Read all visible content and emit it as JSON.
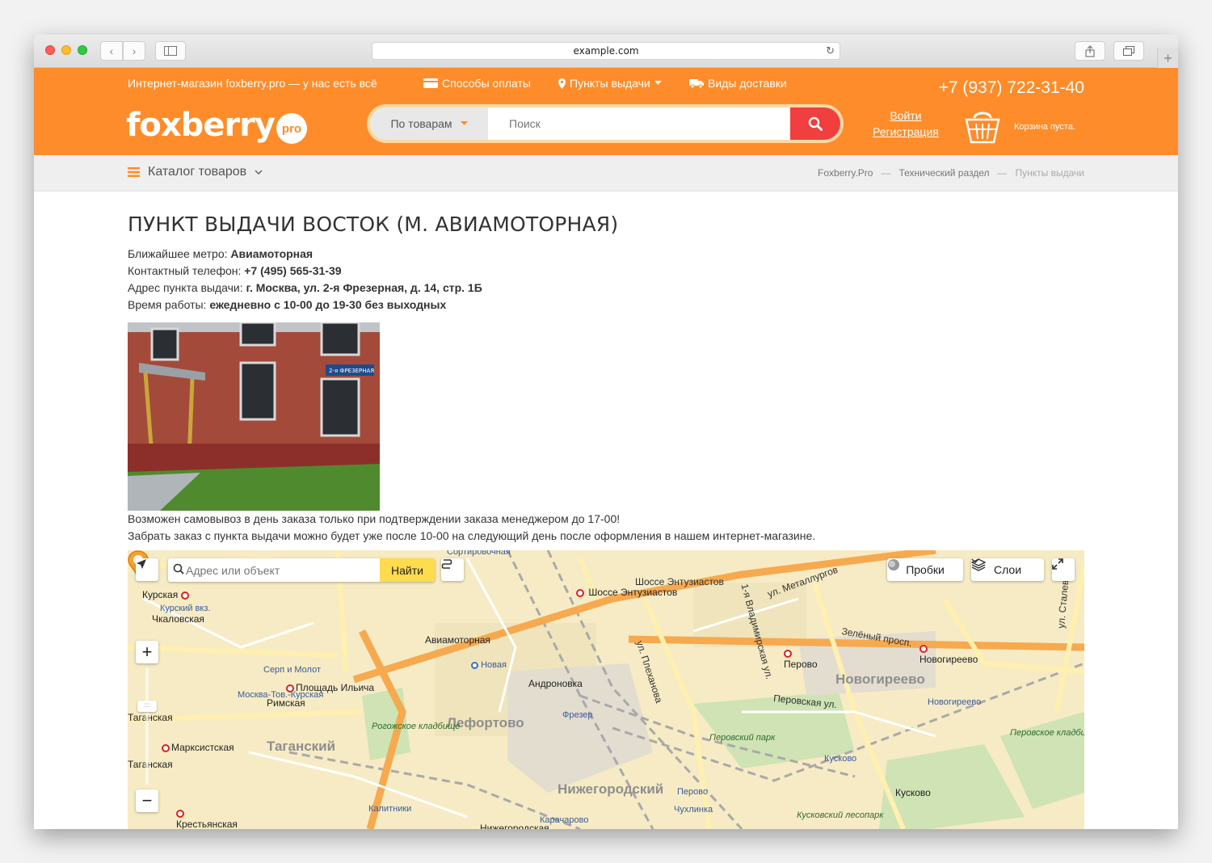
{
  "browser": {
    "url": "example.com"
  },
  "header": {
    "tagline": "Интернет-магазин foxberry.pro — у нас есть всё",
    "nav": {
      "payment": "Способы оплаты",
      "pickup_points": "Пункты выдачи",
      "delivery": "Виды доставки"
    },
    "phone": "+7 (937) 722-31-40",
    "logo_text": "foxberry",
    "logo_badge": "pro",
    "search": {
      "category": "По товарам",
      "placeholder": "Поиск"
    },
    "login": "Войти",
    "register": "Регистрация",
    "cart_text": "Корзина пуста."
  },
  "catbar": {
    "catalog": "Каталог товаров",
    "breadcrumb": [
      "Foxberry.Pro",
      "Технический раздел",
      "Пункты выдачи"
    ]
  },
  "page": {
    "title": "ПУНКТ ВЫДАЧИ ВОСТОК (М. АВИАМОТОРНАЯ)",
    "metro_label": "Ближайшее метро:",
    "metro_value": "Авиамоторная",
    "phone_label": "Контактный телефон:",
    "phone_value": "+7 (495) 565-31-39",
    "address_label": "Адрес пункта выдачи:",
    "address_value": "г. Москва, ул. 2-я Фрезерная, д. 14, стр. 1Б",
    "hours_label": "Время работы:",
    "hours_value": "ежедневно с 10-00 до 19-30 без выходных",
    "photo_sign": "2-я ФРЕЗЕРНАЯ",
    "note1": "Возможен самовывоз в день заказа только при подтверждении заказа менеджером до 17-00!",
    "note2": "Забрать заказ с пункта выдачи можно будет уже после 10-00 на следующий день после оформления в нашем интернет-магазине."
  },
  "map": {
    "search_placeholder": "Адрес или объект",
    "find": "Найти",
    "traffic": "Пробки",
    "layers": "Слои",
    "districts": [
      "Лефортово",
      "Таганский",
      "Нижегородский",
      "Новогиреево"
    ],
    "metro": [
      "Курская",
      "Чкаловская",
      "Авиамоторная",
      "Шоссе Энтузиастов",
      "Площадь Ильича",
      "Римская",
      "Марксистская",
      "Таганская",
      "Таганская",
      "Перово",
      "Новогиреево",
      "Крестьянская"
    ],
    "stations": [
      "Курский вкз.",
      "Серп и Молот",
      "Москва-Тов.-Курская",
      "Новая",
      "Андроновка",
      "Фрезер",
      "Калитники",
      "Перово",
      "Чухлинка",
      "Карачарово",
      "Кусково",
      "Кусково",
      "Новогиреево",
      "Нижегородская"
    ],
    "streets": [
      "Шоссе Энтузиастов",
      "ул. Плеханова",
      "1-я Владимирская ул.",
      "ул. Металлургов",
      "Зелёный просп.",
      "Перовская ул.",
      "ул. Сталеваров",
      "Рогожское кладбище",
      "Сортировочная"
    ],
    "parks": [
      "Перовский парк",
      "Кусковский лесопарк",
      "Перовское кладбище"
    ]
  },
  "colors": {
    "brand_orange": "#ff8c2a",
    "search_red": "#f13e3e",
    "find_yellow": "#ffdb4d"
  }
}
